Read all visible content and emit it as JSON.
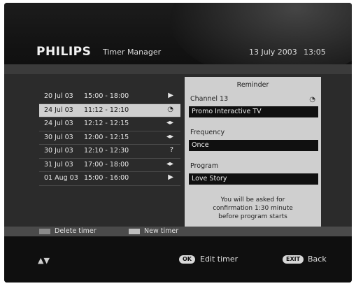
{
  "header": {
    "brand": "PHILIPS",
    "app_title": "Timer Manager",
    "date": "13 July 2003",
    "time": "13:05"
  },
  "timer_list": [
    {
      "date": "20 Jul 03",
      "time": "15:00 - 18:00",
      "mode_icon": "play-icon",
      "mode_glyph": "▶"
    },
    {
      "date": "24 Jul 03",
      "time": "11:12 - 12:10",
      "mode_icon": "reminder-icon",
      "mode_glyph": "◔"
    },
    {
      "date": "24 Jul 03",
      "time": "12:12 - 12:15",
      "mode_icon": "repeat-icon",
      "mode_glyph": "◂▸"
    },
    {
      "date": "30 Jul 03",
      "time": "12:00 - 12:15",
      "mode_icon": "repeat-icon",
      "mode_glyph": "◂▸"
    },
    {
      "date": "30 Jul 03",
      "time": "12:10 - 12:30",
      "mode_icon": "question-icon",
      "mode_glyph": "?"
    },
    {
      "date": "31 Jul 03",
      "time": "17:00 - 18:00",
      "mode_icon": "repeat-icon",
      "mode_glyph": "◂▸"
    },
    {
      "date": "01 Aug 03",
      "time": "15:00 - 16:00",
      "mode_icon": "play-icon",
      "mode_glyph": "▶"
    }
  ],
  "selected_index": 1,
  "detail": {
    "title": "Reminder",
    "channel_label": "Channel 13",
    "channel_icon": "reminder-icon",
    "channel_value": "Promo Interactive TV",
    "frequency_label": "Frequency",
    "frequency_value": "Once",
    "program_label": "Program",
    "program_value": "Love Story",
    "note_line1": "You will be asked for",
    "note_line2": "confirmation 1:30 minute",
    "note_line3": "before program starts"
  },
  "color_keys": {
    "delete_label": "Delete timer",
    "new_label": "New timer",
    "delete_color": "#8a8a8a",
    "new_color": "#bdbdbd"
  },
  "footer": {
    "nav_glyph": "▲▼",
    "ok_key": "OK",
    "ok_label": "Edit timer",
    "exit_key": "EXIT",
    "exit_label": "Back"
  }
}
